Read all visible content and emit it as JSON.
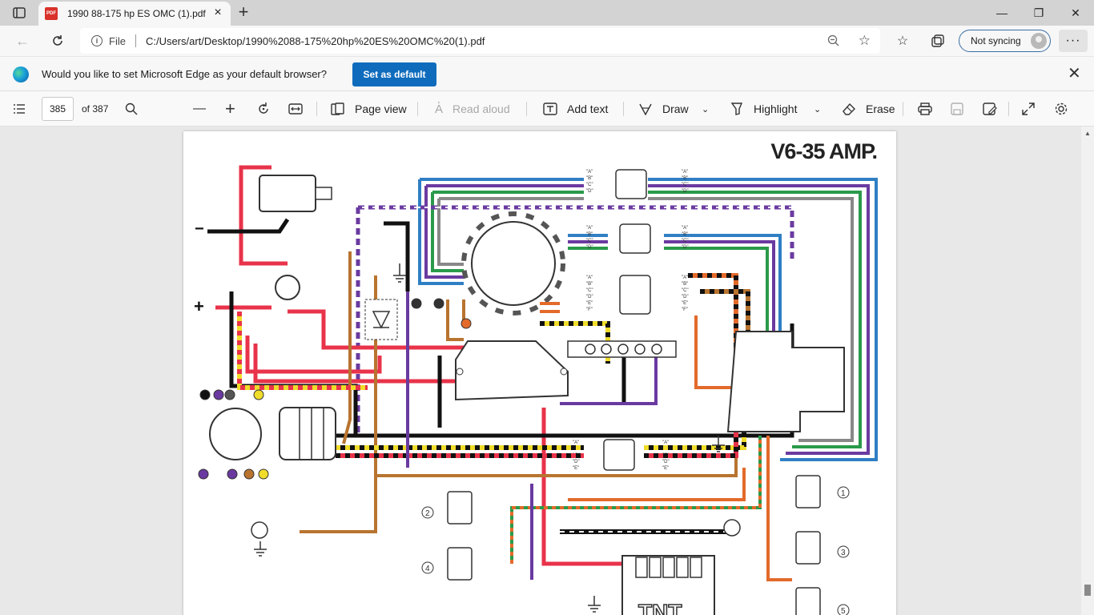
{
  "tab": {
    "title": "1990 88-175 hp ES OMC (1).pdf",
    "icon": "pdf-file-icon"
  },
  "window": {
    "minimize": "—",
    "maximize": "❐",
    "close": "✕"
  },
  "address": {
    "scheme_label": "File",
    "url": "C:/Users/art/Desktop/1990%2088-175%20hp%20ES%20OMC%20(1).pdf"
  },
  "profile": {
    "sync_label": "Not syncing"
  },
  "infobar": {
    "message": "Would you like to set Microsoft Edge as your default browser?",
    "button_label": "Set as default"
  },
  "pdf_toolbar": {
    "page_number": "385",
    "page_total": "of 387",
    "page_view_label": "Page view",
    "read_aloud_label": "Read aloud",
    "add_text_label": "Add text",
    "draw_label": "Draw",
    "highlight_label": "Highlight",
    "erase_label": "Erase"
  },
  "document": {
    "diagram_title": "V6-35 AMP.",
    "connector_labels_4": [
      "\"A\"",
      "\"B\"",
      "\"C\"",
      "\"D\""
    ],
    "connector_labels_6": [
      "\"A\"",
      "\"B\"",
      "\"C\"",
      "\"D\"",
      "\"E\"",
      "\"F\""
    ],
    "connector_labels_5": [
      "\"A\"",
      "\"B\"",
      "\"C\"",
      "\"D\"",
      "\"E\""
    ],
    "ignition_numbers": [
      "1",
      "2",
      "3",
      "4",
      "5"
    ],
    "polarity_minus": "−",
    "polarity_plus": "+",
    "module_label": "TNT"
  },
  "colors": {
    "accent": "#0f6cbd",
    "wire_red": "#e8334a",
    "wire_blue": "#2f7fc4",
    "wire_green": "#2a9a4a",
    "wire_purple": "#6a3aa0",
    "wire_orange": "#e36a2a",
    "wire_tan": "#b8742f",
    "wire_yellow": "#f0dc2a",
    "wire_black": "#111111",
    "wire_gray": "#888888"
  }
}
